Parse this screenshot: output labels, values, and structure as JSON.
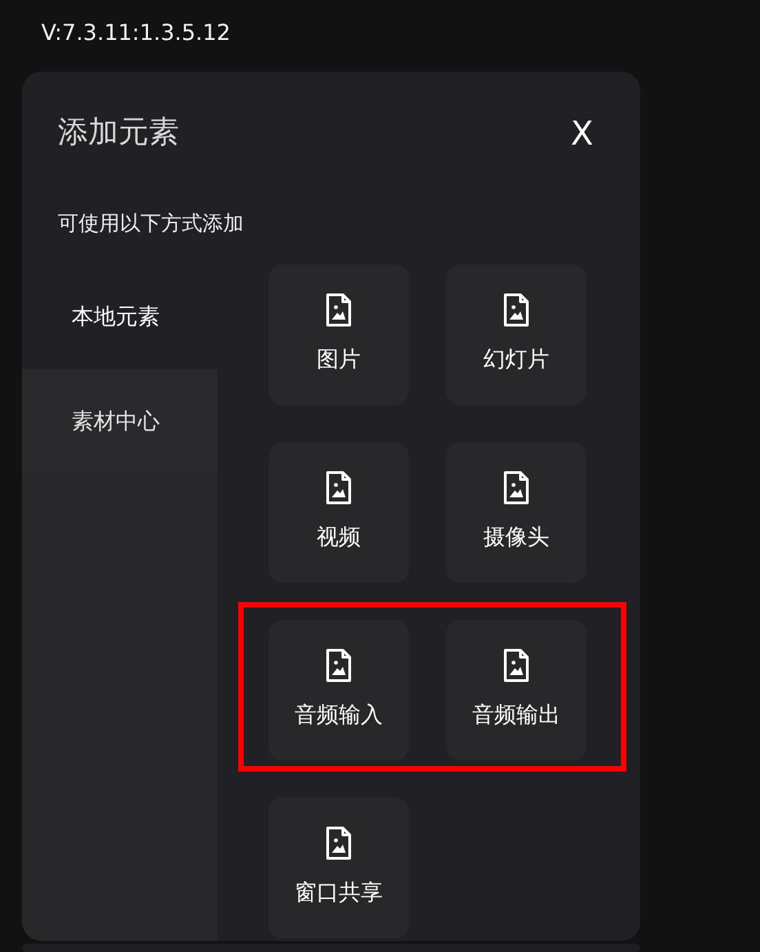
{
  "version": "V:7.3.11:1.3.5.12",
  "dialog": {
    "title": "添加元素",
    "close": "X",
    "subtitle": "可使用以下方式添加"
  },
  "sidebar": {
    "items": [
      {
        "label": "本地元素",
        "selected": true
      },
      {
        "label": "素材中心",
        "selected": false
      }
    ]
  },
  "tile_rows": [
    {
      "highlighted": false,
      "tiles": [
        {
          "label": "图片"
        },
        {
          "label": "幻灯片"
        }
      ]
    },
    {
      "highlighted": false,
      "tiles": [
        {
          "label": "视频"
        },
        {
          "label": "摄像头"
        }
      ]
    },
    {
      "highlighted": true,
      "tiles": [
        {
          "label": "音频输入"
        },
        {
          "label": "音频输出"
        }
      ]
    },
    {
      "highlighted": false,
      "tiles": [
        {
          "label": "窗口共享"
        }
      ]
    }
  ]
}
